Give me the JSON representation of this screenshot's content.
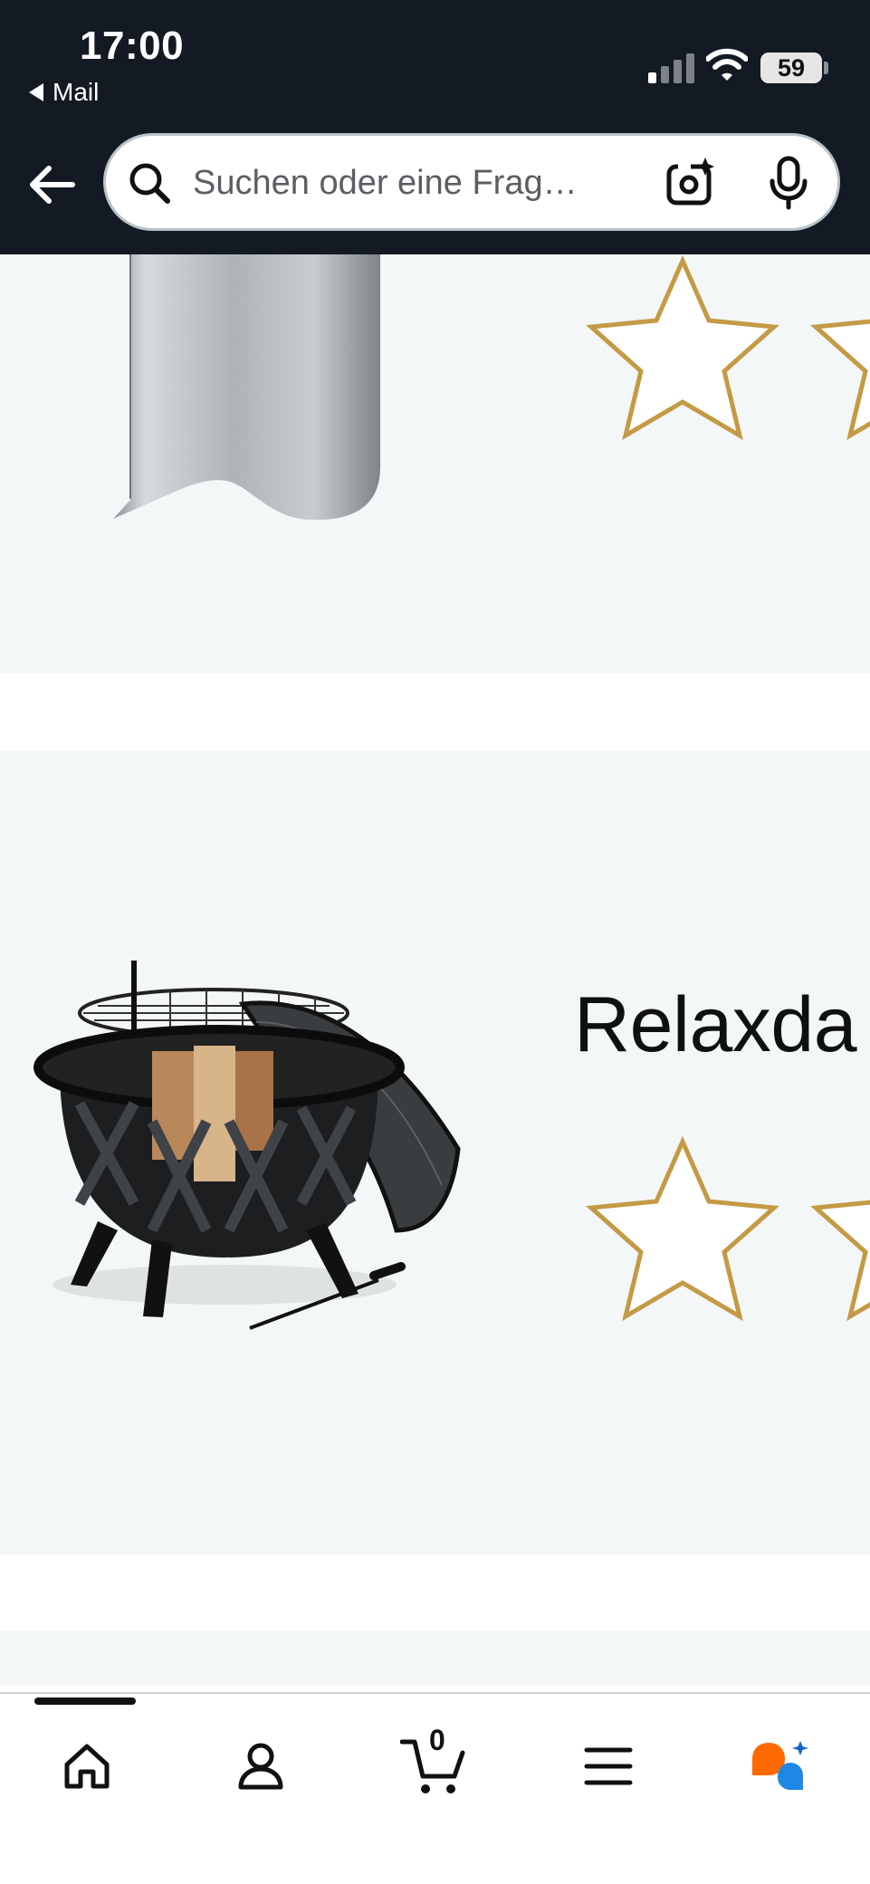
{
  "status_bar": {
    "time": "17:00",
    "back_app": "Mail",
    "battery": "59"
  },
  "search": {
    "placeholder": "Suchen oder eine Frag…"
  },
  "products": [
    {
      "title": "",
      "rating_stars": 5
    },
    {
      "title": "Relaxda",
      "rating_stars": 5
    }
  ],
  "tabbar": {
    "cart_count": "0",
    "icons": [
      "home-icon",
      "account-icon",
      "cart-icon",
      "menu-icon",
      "rufus-icon"
    ]
  },
  "colors": {
    "header_bg": "#131a24",
    "card_bg": "#f4f7f8",
    "star_outline": "#c49a45",
    "rufus_orange": "#ff6a00",
    "rufus_blue": "#1e88e5"
  }
}
